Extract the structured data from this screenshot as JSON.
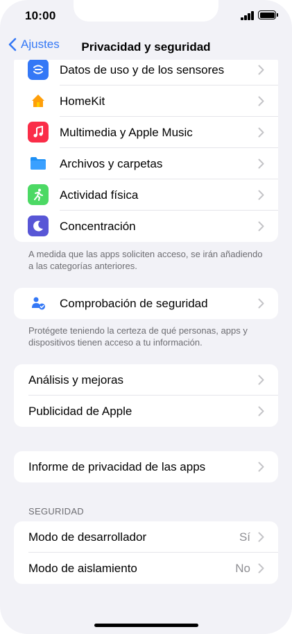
{
  "status": {
    "time": "10:00"
  },
  "nav": {
    "back_label": "Ajustes",
    "title": "Privacidad y seguridad"
  },
  "group1": {
    "items": [
      {
        "label": "Datos de uso y de los sensores",
        "icon": "sensor-data-icon",
        "color": "#3478f6"
      },
      {
        "label": "HomeKit",
        "icon": "home-icon",
        "color": "#ff9500"
      },
      {
        "label": "Multimedia y Apple Music",
        "icon": "music-note-icon",
        "color": "#fa2d48"
      },
      {
        "label": "Archivos y carpetas",
        "icon": "folder-icon",
        "color": "#1e90f5"
      },
      {
        "label": "Actividad física",
        "icon": "running-figure-icon",
        "color": "#4cd964"
      },
      {
        "label": "Concentración",
        "icon": "moon-icon",
        "color": "#5856d6"
      }
    ],
    "footnote": "A medida que las apps soliciten acceso, se irán añadiendo a las categorías anteriores."
  },
  "group2": {
    "items": [
      {
        "label": "Comprobación de seguridad",
        "icon": "safety-check-icon",
        "color": "#3478f6"
      }
    ],
    "footnote": "Protégete teniendo la certeza de qué personas, apps y dispositivos tienen acceso a tu información."
  },
  "group3": {
    "items": [
      {
        "label": "Análisis y mejoras"
      },
      {
        "label": "Publicidad de Apple"
      }
    ]
  },
  "group4": {
    "items": [
      {
        "label": "Informe de privacidad de las apps"
      }
    ]
  },
  "security": {
    "header": "SEGURIDAD",
    "items": [
      {
        "label": "Modo de desarrollador",
        "value": "Sí"
      },
      {
        "label": "Modo de aislamiento",
        "value": "No"
      }
    ]
  }
}
